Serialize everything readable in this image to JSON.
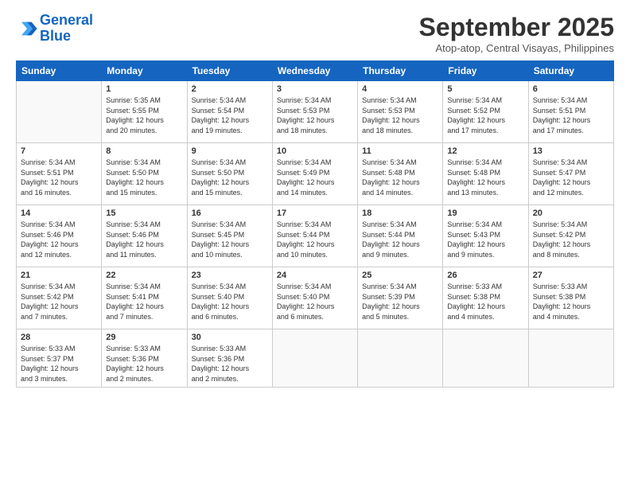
{
  "header": {
    "logo_line1": "General",
    "logo_line2": "Blue",
    "month_title": "September 2025",
    "location": "Atop-atop, Central Visayas, Philippines"
  },
  "days_of_week": [
    "Sunday",
    "Monday",
    "Tuesday",
    "Wednesday",
    "Thursday",
    "Friday",
    "Saturday"
  ],
  "weeks": [
    [
      {
        "day": "",
        "content": ""
      },
      {
        "day": "1",
        "content": "Sunrise: 5:35 AM\nSunset: 5:55 PM\nDaylight: 12 hours\nand 20 minutes."
      },
      {
        "day": "2",
        "content": "Sunrise: 5:34 AM\nSunset: 5:54 PM\nDaylight: 12 hours\nand 19 minutes."
      },
      {
        "day": "3",
        "content": "Sunrise: 5:34 AM\nSunset: 5:53 PM\nDaylight: 12 hours\nand 18 minutes."
      },
      {
        "day": "4",
        "content": "Sunrise: 5:34 AM\nSunset: 5:53 PM\nDaylight: 12 hours\nand 18 minutes."
      },
      {
        "day": "5",
        "content": "Sunrise: 5:34 AM\nSunset: 5:52 PM\nDaylight: 12 hours\nand 17 minutes."
      },
      {
        "day": "6",
        "content": "Sunrise: 5:34 AM\nSunset: 5:51 PM\nDaylight: 12 hours\nand 17 minutes."
      }
    ],
    [
      {
        "day": "7",
        "content": "Sunrise: 5:34 AM\nSunset: 5:51 PM\nDaylight: 12 hours\nand 16 minutes."
      },
      {
        "day": "8",
        "content": "Sunrise: 5:34 AM\nSunset: 5:50 PM\nDaylight: 12 hours\nand 15 minutes."
      },
      {
        "day": "9",
        "content": "Sunrise: 5:34 AM\nSunset: 5:50 PM\nDaylight: 12 hours\nand 15 minutes."
      },
      {
        "day": "10",
        "content": "Sunrise: 5:34 AM\nSunset: 5:49 PM\nDaylight: 12 hours\nand 14 minutes."
      },
      {
        "day": "11",
        "content": "Sunrise: 5:34 AM\nSunset: 5:48 PM\nDaylight: 12 hours\nand 14 minutes."
      },
      {
        "day": "12",
        "content": "Sunrise: 5:34 AM\nSunset: 5:48 PM\nDaylight: 12 hours\nand 13 minutes."
      },
      {
        "day": "13",
        "content": "Sunrise: 5:34 AM\nSunset: 5:47 PM\nDaylight: 12 hours\nand 12 minutes."
      }
    ],
    [
      {
        "day": "14",
        "content": "Sunrise: 5:34 AM\nSunset: 5:46 PM\nDaylight: 12 hours\nand 12 minutes."
      },
      {
        "day": "15",
        "content": "Sunrise: 5:34 AM\nSunset: 5:46 PM\nDaylight: 12 hours\nand 11 minutes."
      },
      {
        "day": "16",
        "content": "Sunrise: 5:34 AM\nSunset: 5:45 PM\nDaylight: 12 hours\nand 10 minutes."
      },
      {
        "day": "17",
        "content": "Sunrise: 5:34 AM\nSunset: 5:44 PM\nDaylight: 12 hours\nand 10 minutes."
      },
      {
        "day": "18",
        "content": "Sunrise: 5:34 AM\nSunset: 5:44 PM\nDaylight: 12 hours\nand 9 minutes."
      },
      {
        "day": "19",
        "content": "Sunrise: 5:34 AM\nSunset: 5:43 PM\nDaylight: 12 hours\nand 9 minutes."
      },
      {
        "day": "20",
        "content": "Sunrise: 5:34 AM\nSunset: 5:42 PM\nDaylight: 12 hours\nand 8 minutes."
      }
    ],
    [
      {
        "day": "21",
        "content": "Sunrise: 5:34 AM\nSunset: 5:42 PM\nDaylight: 12 hours\nand 7 minutes."
      },
      {
        "day": "22",
        "content": "Sunrise: 5:34 AM\nSunset: 5:41 PM\nDaylight: 12 hours\nand 7 minutes."
      },
      {
        "day": "23",
        "content": "Sunrise: 5:34 AM\nSunset: 5:40 PM\nDaylight: 12 hours\nand 6 minutes."
      },
      {
        "day": "24",
        "content": "Sunrise: 5:34 AM\nSunset: 5:40 PM\nDaylight: 12 hours\nand 6 minutes."
      },
      {
        "day": "25",
        "content": "Sunrise: 5:34 AM\nSunset: 5:39 PM\nDaylight: 12 hours\nand 5 minutes."
      },
      {
        "day": "26",
        "content": "Sunrise: 5:33 AM\nSunset: 5:38 PM\nDaylight: 12 hours\nand 4 minutes."
      },
      {
        "day": "27",
        "content": "Sunrise: 5:33 AM\nSunset: 5:38 PM\nDaylight: 12 hours\nand 4 minutes."
      }
    ],
    [
      {
        "day": "28",
        "content": "Sunrise: 5:33 AM\nSunset: 5:37 PM\nDaylight: 12 hours\nand 3 minutes."
      },
      {
        "day": "29",
        "content": "Sunrise: 5:33 AM\nSunset: 5:36 PM\nDaylight: 12 hours\nand 2 minutes."
      },
      {
        "day": "30",
        "content": "Sunrise: 5:33 AM\nSunset: 5:36 PM\nDaylight: 12 hours\nand 2 minutes."
      },
      {
        "day": "",
        "content": ""
      },
      {
        "day": "",
        "content": ""
      },
      {
        "day": "",
        "content": ""
      },
      {
        "day": "",
        "content": ""
      }
    ]
  ]
}
